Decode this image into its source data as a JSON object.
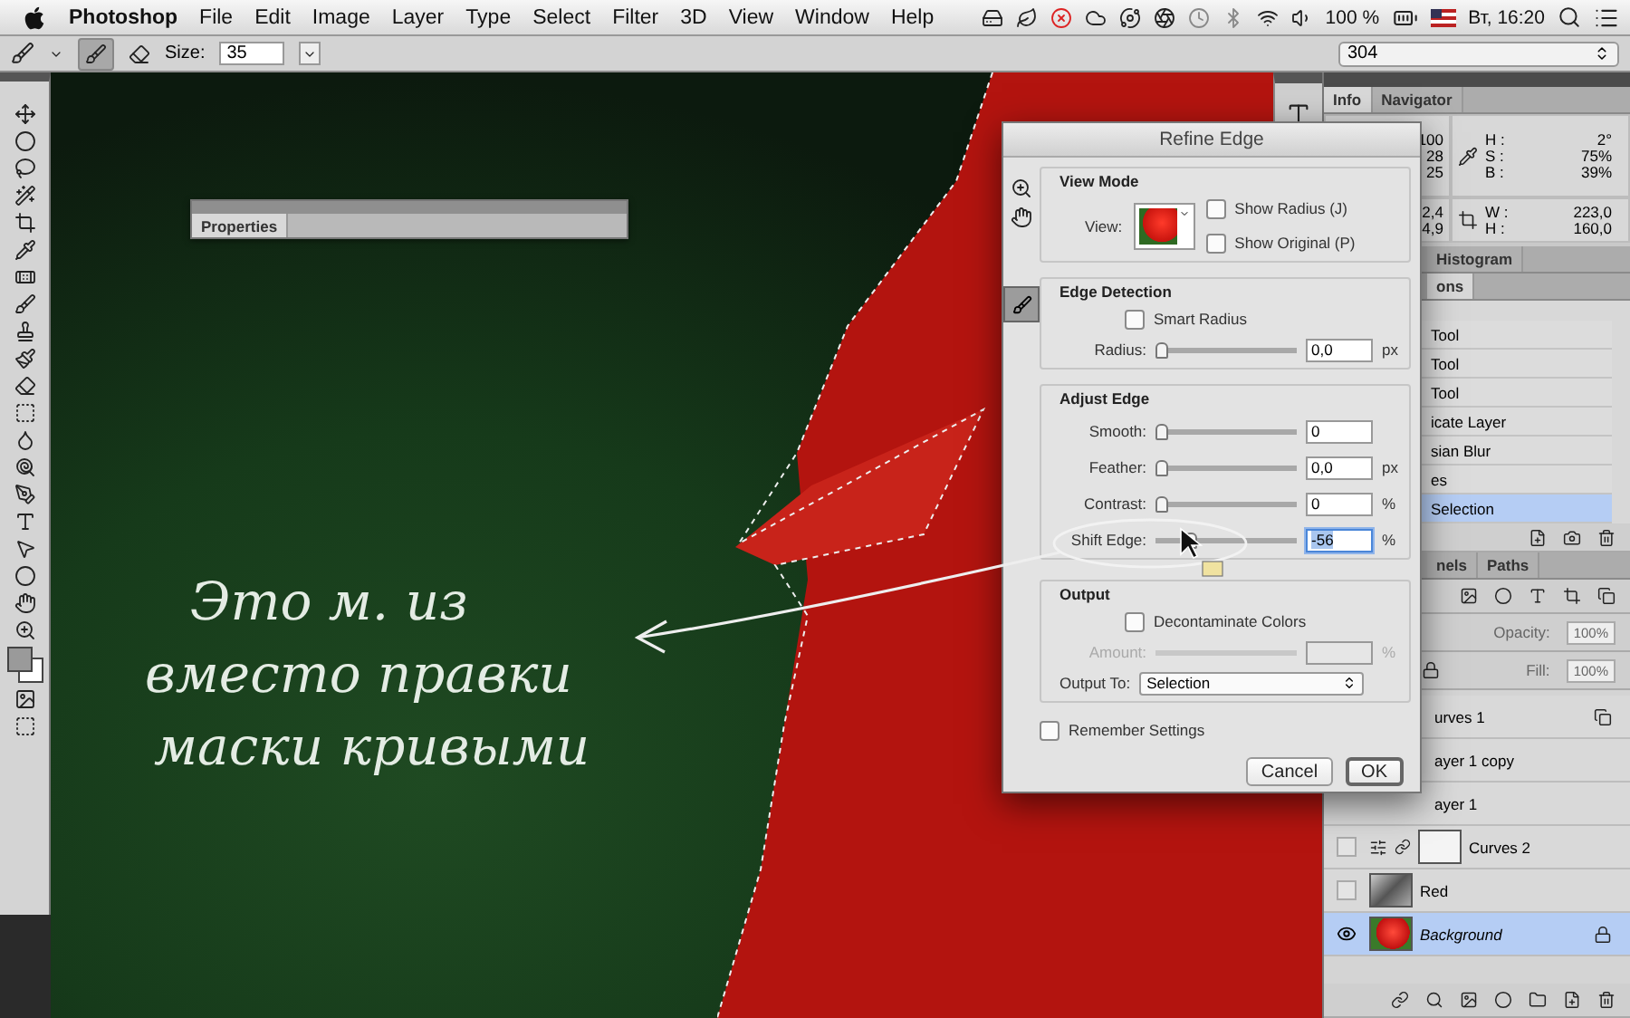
{
  "menu_bar": {
    "app": "Photoshop",
    "items": [
      "File",
      "Edit",
      "Image",
      "Layer",
      "Type",
      "Select",
      "Filter",
      "3D",
      "View",
      "Window",
      "Help"
    ],
    "battery": "100 %",
    "clock": "Вт, 16:20"
  },
  "options_bar": {
    "size_label": "Size:",
    "size": "35",
    "preset": "304"
  },
  "properties_panel": {
    "tab": "Properties"
  },
  "annotation": {
    "lines": [
      "Это м. из",
      "вместо правки",
      "маски кривыми"
    ]
  },
  "dialog": {
    "title": "Refine Edge",
    "view_mode": {
      "title": "View Mode",
      "view_label": "View:",
      "options": [
        {
          "label": "Show Radius (J)",
          "checked": false
        },
        {
          "label": "Show Original (P)",
          "checked": false
        }
      ]
    },
    "edge_detection": {
      "title": "Edge Detection",
      "smart_radius": {
        "label": "Smart Radius",
        "checked": false
      },
      "sliders": [
        {
          "label": "Radius:",
          "value": "0,0",
          "unit": "px",
          "level": 0,
          "selected": false
        }
      ]
    },
    "adjust_edge": {
      "title": "Adjust Edge",
      "sliders": [
        {
          "label": "Smooth:",
          "value": "0",
          "level": 0,
          "selected": false
        },
        {
          "label": "Feather:",
          "value": "0,0",
          "unit": "px",
          "level": 0,
          "selected": false
        },
        {
          "label": "Contrast:",
          "value": "0",
          "unit": "%",
          "level": 0,
          "selected": false
        },
        {
          "label": "Shift Edge:",
          "value": "-56",
          "unit": "%",
          "level": 0.22,
          "selected": true
        }
      ]
    },
    "output": {
      "title": "Output",
      "decontaminate": {
        "label": "Decontaminate Colors",
        "checked": false
      },
      "amount": {
        "label": "Amount:",
        "unit": "%",
        "disabled": true
      },
      "output_to_label": "Output To:",
      "output_to": "Selection"
    },
    "remember": {
      "label": "Remember Settings",
      "checked": false
    },
    "buttons": [
      {
        "label": "Cancel",
        "default": false
      },
      {
        "label": "OK",
        "default": true
      }
    ]
  },
  "info_panel": {
    "tabs": [
      {
        "label": "Info",
        "selected": true
      },
      {
        "label": "Navigator",
        "selected": false
      }
    ],
    "rgb_values": [
      "100",
      "28",
      "25"
    ],
    "hsb": [
      {
        "label": "H :",
        "value": "2°"
      },
      {
        "label": "S :",
        "value": "75%"
      },
      {
        "label": "B :",
        "value": "39%"
      }
    ],
    "xy_values": [
      "2,4",
      "4,9"
    ],
    "size": [
      {
        "label": "W :",
        "value": "223,0"
      },
      {
        "label": "H :",
        "value": "160,0"
      }
    ]
  },
  "histogram_tab": "Histogram",
  "history_panel": {
    "tab": "ons",
    "items": [
      {
        "label": "Tool",
        "selected": false
      },
      {
        "label": "Tool",
        "selected": false
      },
      {
        "label": "Tool",
        "selected": false
      },
      {
        "label": "icate Layer",
        "selected": false
      },
      {
        "label": "sian Blur",
        "selected": false
      },
      {
        "label": "es",
        "selected": false
      },
      {
        "label": "Selection",
        "selected": true
      }
    ]
  },
  "layers_panel": {
    "tabs": [
      {
        "label": "nels",
        "selected": false
      },
      {
        "label": "Paths",
        "selected": false
      }
    ],
    "opacity_label": "Opacity:",
    "opacity": "100%",
    "fill_label": "Fill:",
    "fill": "100%",
    "layers": [
      {
        "name": "urves 1",
        "kind": "plain",
        "linked": true,
        "locked": false,
        "selected": false
      },
      {
        "name": "ayer 1 copy",
        "kind": "plain",
        "linked": false,
        "locked": false,
        "selected": false
      },
      {
        "name": "ayer 1",
        "kind": "plain",
        "linked": false,
        "locked": false,
        "selected": false
      },
      {
        "name": "Curves 2",
        "kind": "adjustment",
        "visible": false,
        "linked": false,
        "locked": false,
        "selected": false
      },
      {
        "name": "Red",
        "kind": "grayscale",
        "visible": false,
        "linked": false,
        "locked": false,
        "selected": false
      },
      {
        "name": "Background",
        "kind": "photo",
        "visible": true,
        "linked": false,
        "locked": true,
        "selected": true
      }
    ]
  }
}
